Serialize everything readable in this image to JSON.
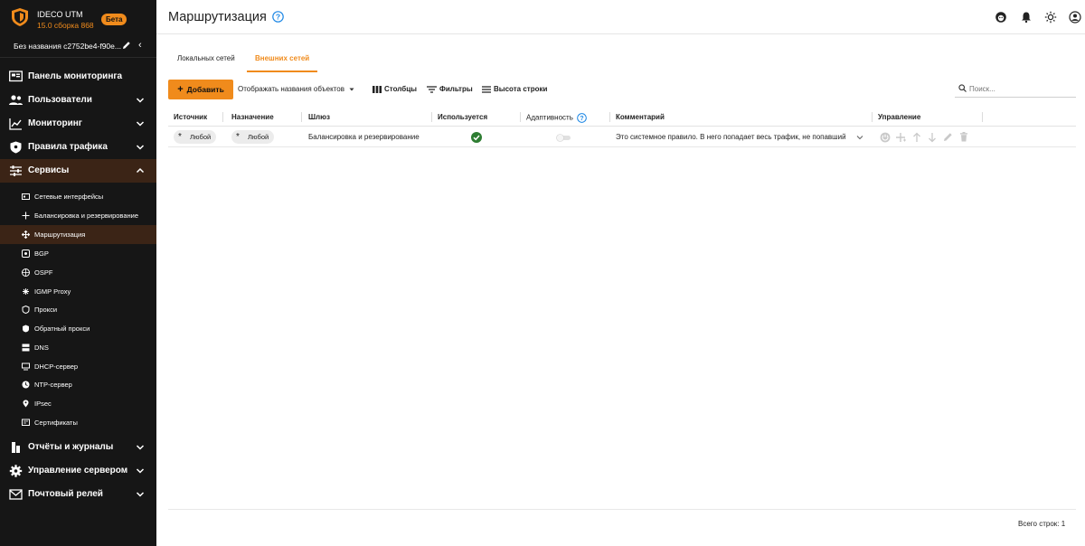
{
  "brand": {
    "name": "IDECO UTM",
    "version": "15.0 сборка 868",
    "badge": "Бета"
  },
  "device": {
    "name": "Без названия c2752be4-f90e..."
  },
  "nav": [
    {
      "label": "Панель мониторинга",
      "icon": "dashboard-icon"
    },
    {
      "label": "Пользователи",
      "icon": "users-icon"
    },
    {
      "label": "Мониторинг",
      "icon": "chart-line-icon"
    },
    {
      "label": "Правила трафика",
      "icon": "shield-icon"
    },
    {
      "label": "Сервисы",
      "icon": "sliders-icon"
    }
  ],
  "services": [
    "Сетевые интерфейсы",
    "Балансировка и резервирование",
    "Маршрутизация",
    "BGP",
    "OSPF",
    "IGMP Proxy",
    "Прокси",
    "Обратный прокси",
    "DNS",
    "DHCP-сервер",
    "NTP-сервер",
    "IPsec",
    "Сертификаты"
  ],
  "nav_bottom": [
    {
      "label": "Отчёты и журналы",
      "icon": "reports-icon"
    },
    {
      "label": "Управление сервером",
      "icon": "gear-icon"
    },
    {
      "label": "Почтовый релей",
      "icon": "mail-icon"
    }
  ],
  "page": {
    "title": "Маршрутизация"
  },
  "tabs": [
    "Локальных сетей",
    "Внешних сетей"
  ],
  "toolbar": {
    "add": "Добавить",
    "show_names": "Отображать названия объектов",
    "columns": "Столбцы",
    "filters": "Фильтры",
    "row_height": "Высота строки",
    "search_placeholder": "Поиск..."
  },
  "table": {
    "headers": [
      "Источник",
      "Назначение",
      "Шлюз",
      "Используется",
      "Адаптивность",
      "Комментарий",
      "Управление"
    ],
    "rows": [
      {
        "source": "Любой",
        "destination": "Любой",
        "gateway": "Балансировка и резервирование",
        "used": true,
        "adaptive": false,
        "comment": "Это системное правило. В него попадает весь трафик, не попавший"
      }
    ]
  },
  "footer": {
    "total": "Всего строк: 1"
  },
  "colors": {
    "accent": "#f08b1c",
    "sidebar": "#161616",
    "active": "#3b2416",
    "success": "#2e7d32",
    "help": "#1e88e5"
  }
}
